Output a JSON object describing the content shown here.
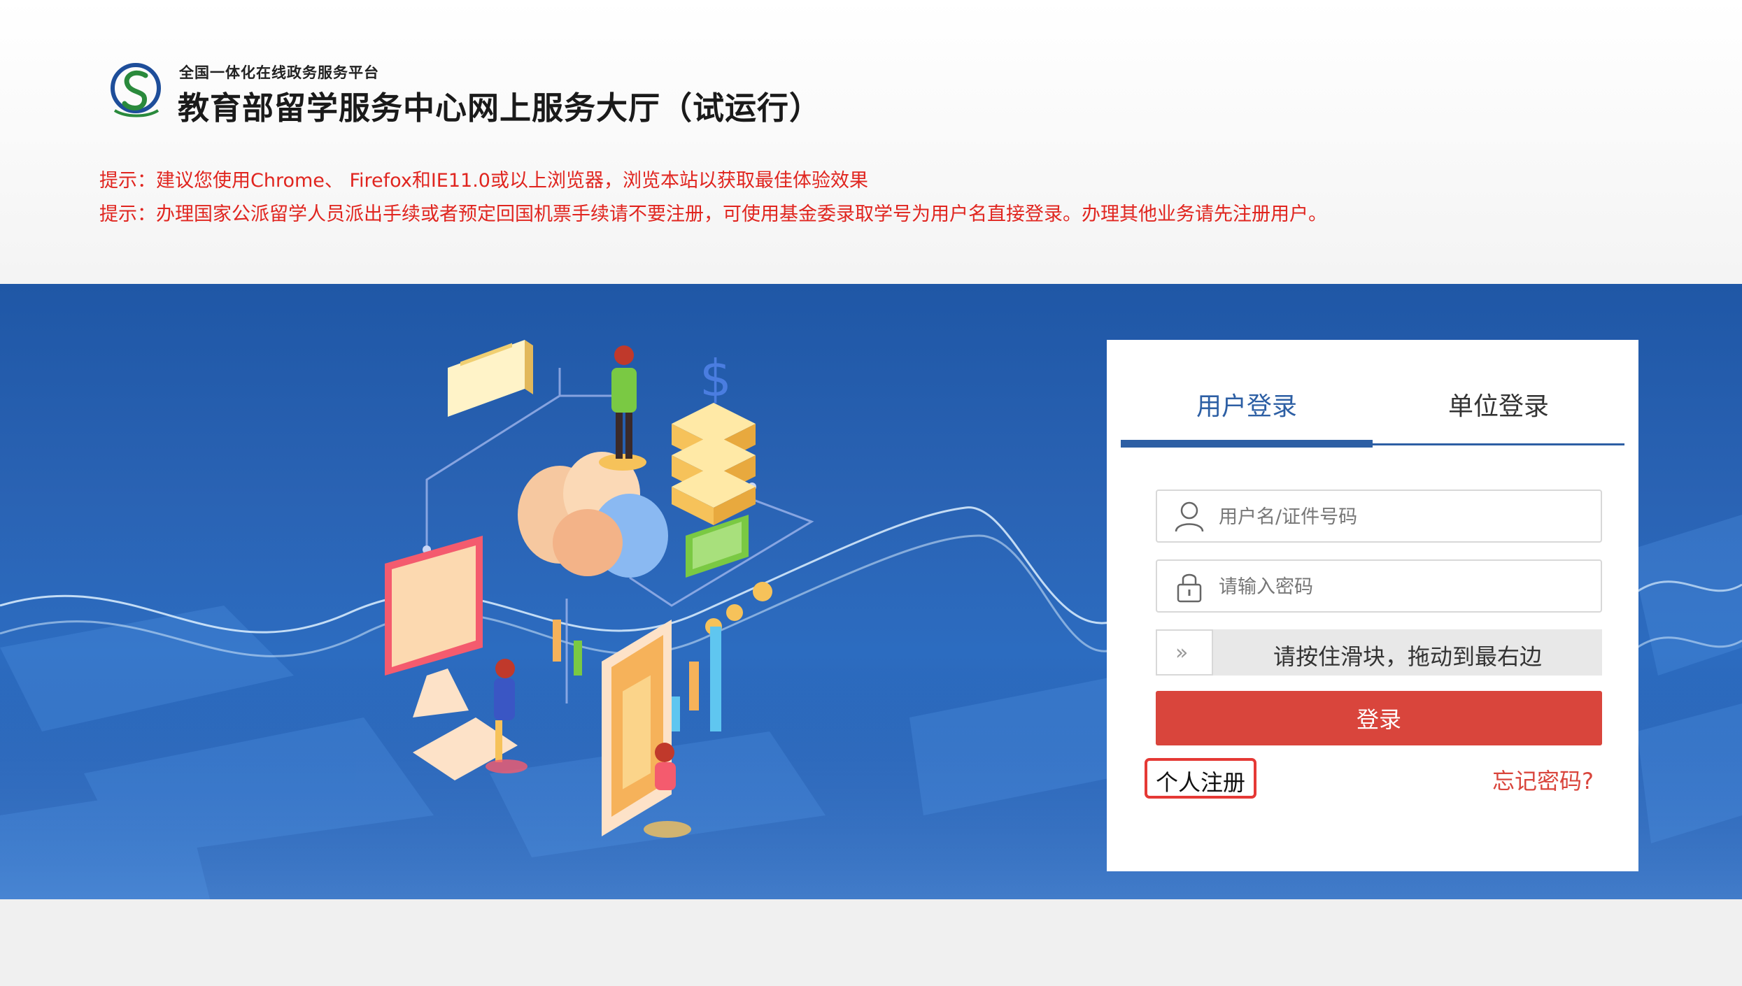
{
  "header": {
    "platform_name": "全国一体化在线政务服务平台",
    "site_title": "教育部留学服务中心网上服务大厅（试运行）",
    "logo_icon": "cscse-logo-icon"
  },
  "tips": [
    "提示：建议您使用Chrome、 Firefox和IE11.0或以上浏览器，浏览本站以获取最佳体验效果",
    "提示：办理国家公派留学人员派出手续或者预定回国机票手续请不要注册，可使用基金委录取学号为用户名直接登录。办理其他业务请先注册用户。"
  ],
  "login": {
    "tabs": [
      {
        "label": "用户登录",
        "active": true
      },
      {
        "label": "单位登录",
        "active": false
      }
    ],
    "username": {
      "placeholder": "用户名/证件号码",
      "value": "",
      "icon": "user-icon"
    },
    "password": {
      "placeholder": "请输入密码",
      "value": "",
      "icon": "lock-icon"
    },
    "slider": {
      "handle": "»",
      "text": "请按住滑块，拖动到最右边",
      "progress": 0
    },
    "submit_label": "登录",
    "register_label": "个人注册",
    "forgot_label": "忘记密码?"
  },
  "colors": {
    "tip_red": "#e0251f",
    "tab_blue": "#2d5fa4",
    "login_button": "#d9453c",
    "banner_blue": "#2a63b4",
    "register_highlight": "#e53935"
  }
}
